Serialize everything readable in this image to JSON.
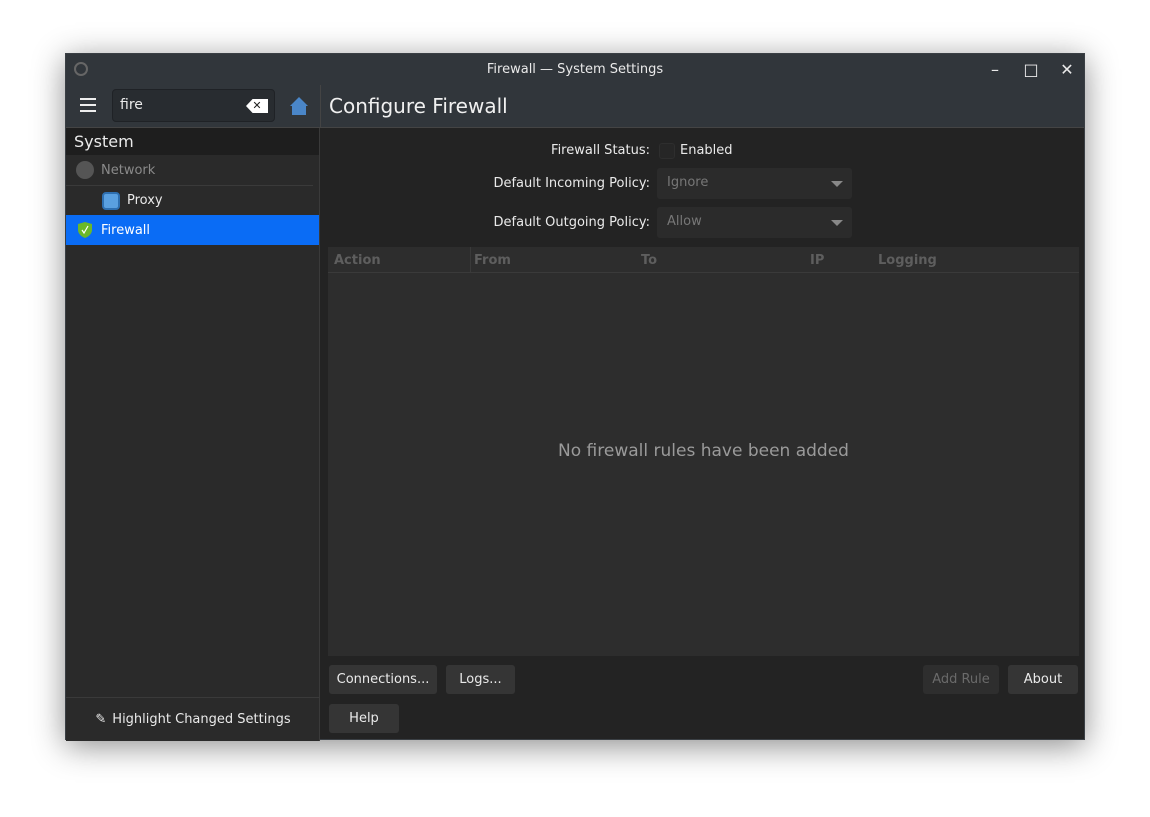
{
  "window": {
    "title": "Firewall — System Settings",
    "controls": [
      "minimize",
      "maximize",
      "close"
    ]
  },
  "header": {
    "search_value": "fire",
    "page_title": "Configure Firewall"
  },
  "sidebar": {
    "category": "System",
    "items": [
      {
        "label": "Network",
        "icon": "network-icon"
      },
      {
        "label": "Proxy",
        "icon": "proxy-icon"
      },
      {
        "label": "Firewall",
        "icon": "firewall-shield-icon",
        "selected": true
      }
    ],
    "footer": "Highlight Changed Settings"
  },
  "form": {
    "status_label": "Firewall Status:",
    "status_value": "Enabled",
    "status_checked": false,
    "incoming_label": "Default Incoming Policy:",
    "incoming_value": "Ignore",
    "outgoing_label": "Default Outgoing Policy:",
    "outgoing_value": "Allow"
  },
  "table": {
    "columns": [
      "Action",
      "From",
      "To",
      "IP",
      "Logging"
    ],
    "empty_text": "No firewall rules have been added"
  },
  "buttons": {
    "connections": "Connections...",
    "logs": "Logs...",
    "add_rule": "Add Rule",
    "about": "About",
    "help": "Help"
  },
  "colors": {
    "accent": "#0a6cf5",
    "shield": "#6bb82a"
  }
}
